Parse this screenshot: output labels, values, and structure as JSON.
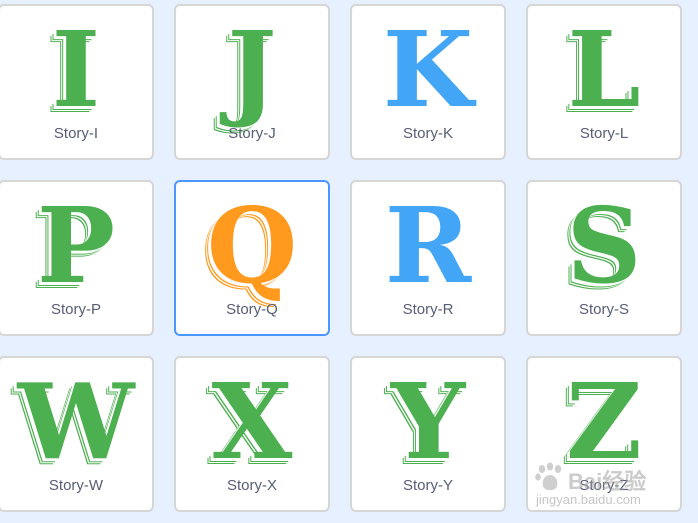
{
  "tiles": [
    {
      "letter": "I",
      "label": "Story-I"
    },
    {
      "letter": "J",
      "label": "Story-J"
    },
    {
      "letter": "K",
      "label": "Story-K"
    },
    {
      "letter": "L",
      "label": "Story-L"
    },
    {
      "letter": "P",
      "label": "Story-P"
    },
    {
      "letter": "Q",
      "label": "Story-Q"
    },
    {
      "letter": "R",
      "label": "Story-R"
    },
    {
      "letter": "S",
      "label": "Story-S"
    },
    {
      "letter": "W",
      "label": "Story-W"
    },
    {
      "letter": "X",
      "label": "Story-X"
    },
    {
      "letter": "Y",
      "label": "Story-Y"
    },
    {
      "letter": "Z",
      "label": "Story-Z"
    }
  ],
  "selected_label": "Story-Q",
  "colors": {
    "green": "#4caf50",
    "blue": "#42a5f5",
    "orange": "#ff9a1f",
    "selected_border": "#4c97ff",
    "background": "#e6f0ff"
  },
  "watermark": {
    "text": "Bai经验",
    "url": "jingyan.baidu.com"
  }
}
